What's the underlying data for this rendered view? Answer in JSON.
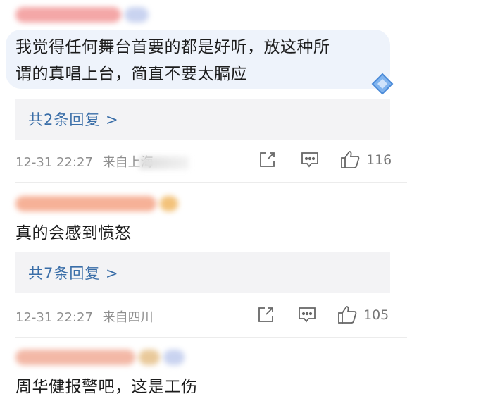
{
  "comments": [
    {
      "text_line1": "我觉得任何舞台首要的都是好听，放这种所",
      "text_line2": "谓的真唱上台，简直不要太膈应",
      "replies": "共2条回复 >",
      "time": "12-31 22:27",
      "location": "来自上海",
      "likes": "116",
      "username_color": "#f4a7a7"
    },
    {
      "text_line1": "真的会感到愤怒",
      "replies": "共7条回复 >",
      "time": "12-31 22:27",
      "location": "来自四川",
      "likes": "105",
      "username_color": "#f6b197"
    },
    {
      "text_line1": "周华健报警吧，这是工伤",
      "username_color": "#f3b8a6"
    }
  ],
  "icons": {
    "share": "share-icon",
    "comment": "comment-icon",
    "like": "thumbs-up-icon",
    "badge": "diamond-badge-icon"
  },
  "colors": {
    "reply_link": "#3a6ea8",
    "bubble": "#eef3fb",
    "meta": "#8f8f8f"
  }
}
